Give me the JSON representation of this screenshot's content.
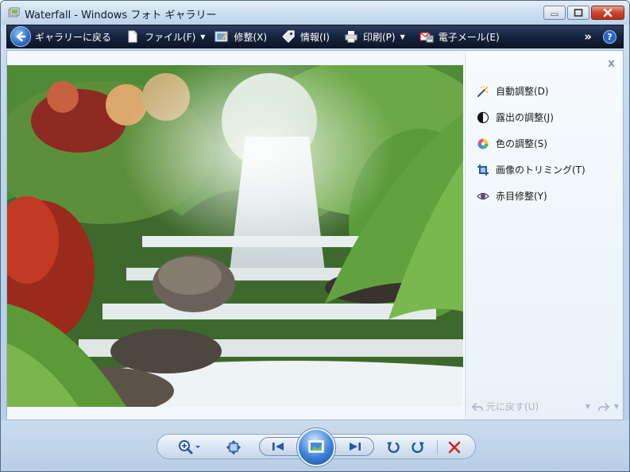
{
  "window": {
    "title": "Waterfall - Windows フォト ギャラリー"
  },
  "commandbar": {
    "back_label": "ギャラリーに戻る",
    "file_label": "ファイル(F)",
    "fix_label": "修整(X)",
    "info_label": "情報(I)",
    "print_label": "印刷(P)",
    "email_label": "電子メール(E)",
    "more_label": "»",
    "help_label": "?"
  },
  "fix_panel": {
    "close_label": "x",
    "items": [
      {
        "label": "自動調整(D)",
        "icon": "magic-wand-icon"
      },
      {
        "label": "露出の調整(J)",
        "icon": "exposure-icon"
      },
      {
        "label": "色の調整(S)",
        "icon": "color-wheel-icon"
      },
      {
        "label": "画像のトリミング(T)",
        "icon": "crop-icon"
      },
      {
        "label": "赤目修整(Y)",
        "icon": "red-eye-icon"
      }
    ],
    "undo_label": "元に戻す(U)"
  },
  "colors": {
    "cmdbar_bg": "#16243d",
    "accent_blue": "#2b6cc4",
    "delete_red": "#d42020"
  }
}
